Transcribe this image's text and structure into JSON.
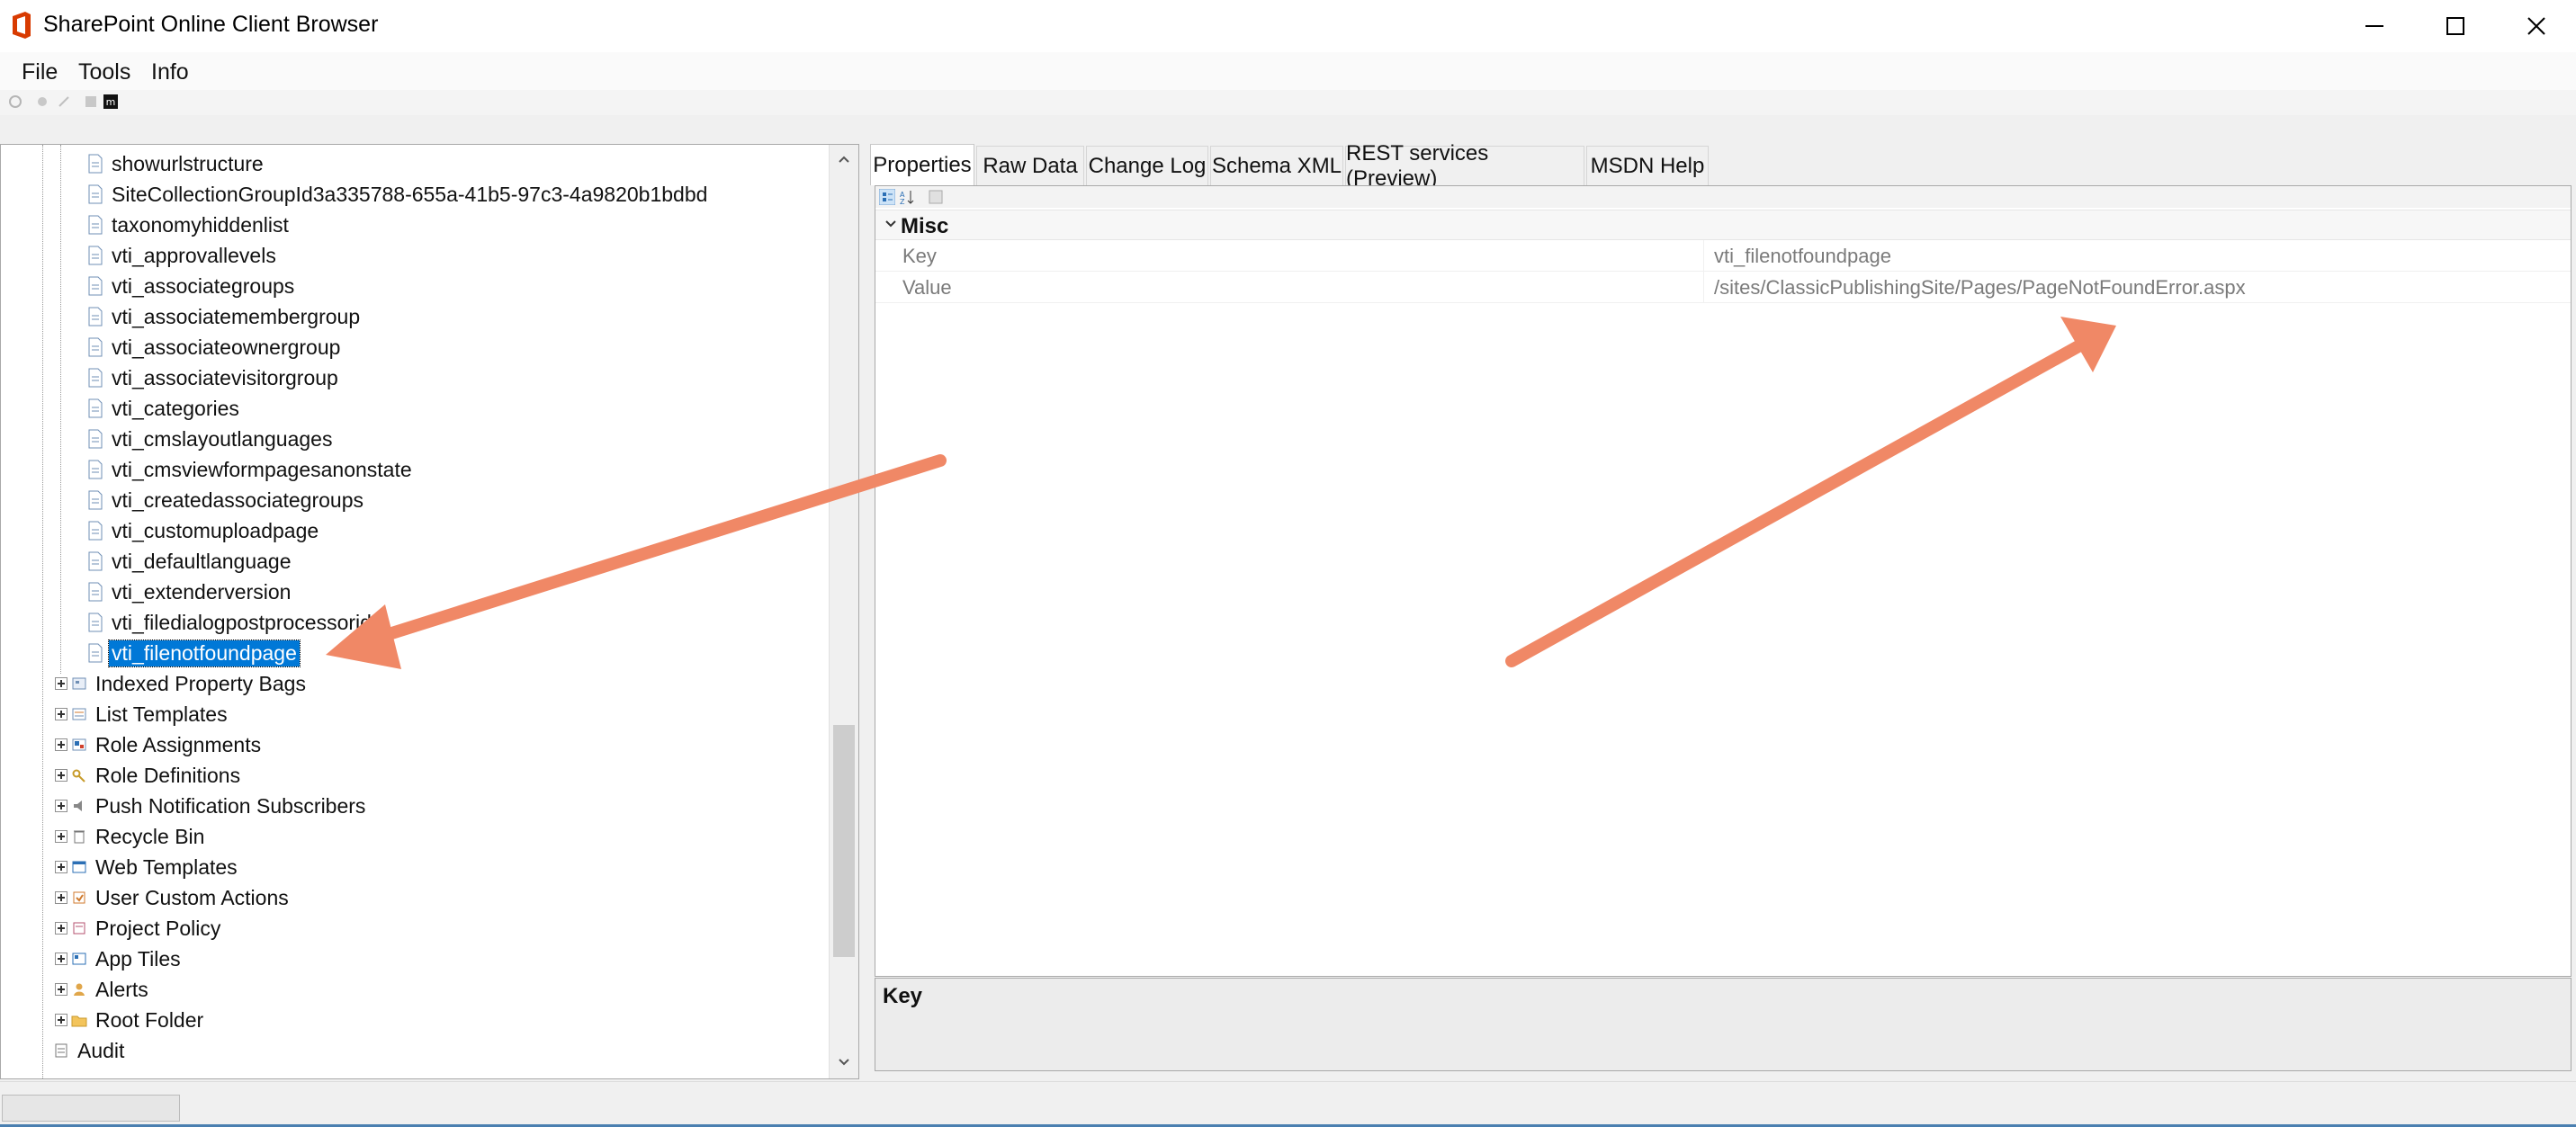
{
  "window": {
    "title": "SharePoint Online Client Browser"
  },
  "menu": [
    "File",
    "Tools",
    "Info"
  ],
  "tree": {
    "items": [
      {
        "label": "showurlstructure",
        "level": 2
      },
      {
        "label": "SiteCollectionGroupId3a335788-655a-41b5-97c3-4a9820b1bdbd",
        "level": 2
      },
      {
        "label": "taxonomyhiddenlist",
        "level": 2
      },
      {
        "label": "vti_approvallevels",
        "level": 2
      },
      {
        "label": "vti_associategroups",
        "level": 2
      },
      {
        "label": "vti_associatemembergroup",
        "level": 2
      },
      {
        "label": "vti_associateownergroup",
        "level": 2
      },
      {
        "label": "vti_associatevisitorgroup",
        "level": 2
      },
      {
        "label": "vti_categories",
        "level": 2
      },
      {
        "label": "vti_cmslayoutlanguages",
        "level": 2
      },
      {
        "label": "vti_cmsviewformpagesanonstate",
        "level": 2
      },
      {
        "label": "vti_createdassociategroups",
        "level": 2
      },
      {
        "label": "vti_customuploadpage",
        "level": 2
      },
      {
        "label": "vti_defaultlanguage",
        "level": 2
      },
      {
        "label": "vti_extenderversion",
        "level": 2
      },
      {
        "label": "vti_filedialogpostprocessorid",
        "level": 2
      },
      {
        "label": "vti_filenotfoundpage",
        "level": 2,
        "selected": true
      },
      {
        "label": "Indexed Property Bags",
        "level": 1
      },
      {
        "label": "List Templates",
        "level": 1
      },
      {
        "label": "Role Assignments",
        "level": 1
      },
      {
        "label": "Role Definitions",
        "level": 1
      },
      {
        "label": "Push Notification Subscribers",
        "level": 1
      },
      {
        "label": "Recycle Bin",
        "level": 1
      },
      {
        "label": "Web Templates",
        "level": 1
      },
      {
        "label": "User Custom Actions",
        "level": 1
      },
      {
        "label": "Project Policy",
        "level": 1
      },
      {
        "label": "App Tiles",
        "level": 1
      },
      {
        "label": "Alerts",
        "level": 1
      },
      {
        "label": "Root Folder",
        "level": 1
      },
      {
        "label": "Audit",
        "level": 0
      }
    ]
  },
  "tabs": [
    "Properties",
    "Raw Data",
    "Change Log",
    "Schema XML",
    "REST services (Preview)",
    "MSDN Help"
  ],
  "active_tab": "Properties",
  "properties": {
    "category": "Misc",
    "rows": [
      {
        "name": "Key",
        "value": "vti_filenotfoundpage"
      },
      {
        "name": "Value",
        "value": "/sites/ClassicPublishingSite/Pages/PageNotFoundError.aspx"
      }
    ]
  },
  "description": {
    "title": "Key"
  },
  "colors": {
    "selection": "#0078d7",
    "annotation_arrow": "#f08866",
    "office_red": "#d83b01"
  }
}
